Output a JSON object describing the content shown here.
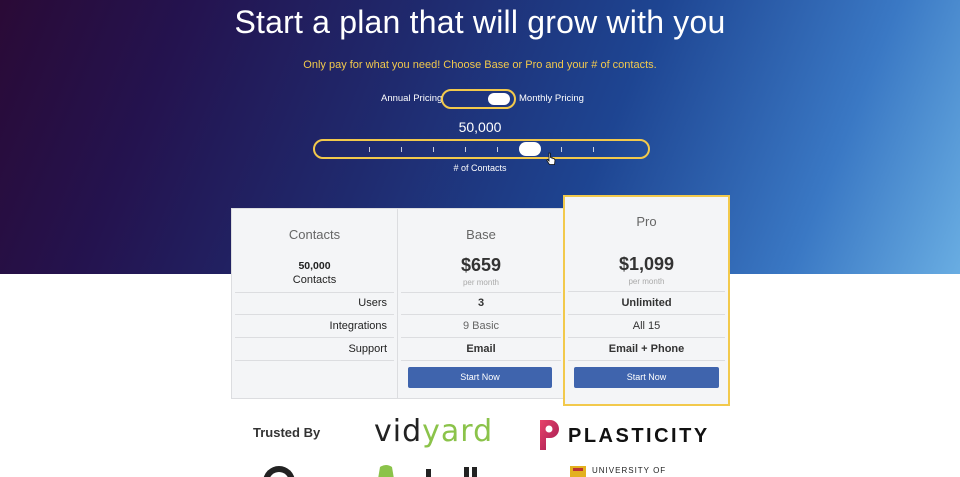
{
  "hero": {
    "headline": "Start a plan that will grow with you",
    "subline": "Only pay for what you need! Choose Base or Pro and your # of contacts."
  },
  "pricing_toggle": {
    "left_label": "Annual Pricing",
    "right_label": "Monthly Pricing",
    "selected": "Monthly Pricing"
  },
  "contacts_slider": {
    "value_label": "50,000",
    "caption": "# of Contacts",
    "position_fraction": 0.64
  },
  "table": {
    "contacts_col": {
      "title": "Contacts",
      "count": "50,000",
      "unit": "Contacts",
      "rows": [
        "Users",
        "Integrations",
        "Support"
      ]
    },
    "base": {
      "title": "Base",
      "price": "$659",
      "period": "per month",
      "users": "3",
      "integrations": "9 Basic",
      "support": "Email",
      "cta": "Start Now"
    },
    "pro": {
      "title": "Pro",
      "price": "$1,099",
      "period": "per month",
      "users": "Unlimited",
      "integrations": "All 15",
      "support": "Email + Phone",
      "cta": "Start Now"
    }
  },
  "trusted": {
    "label": "Trusted By",
    "logos": {
      "vidyard_a": "vid",
      "vidyard_b": "yard",
      "plasticity": "PLASTICITY",
      "waterloo_top": "UNIVERSITY OF"
    }
  },
  "colors": {
    "accent_yellow": "#f2c94c",
    "button_blue": "#3f64ad",
    "vidyard_green": "#8bc34a"
  },
  "icons": [
    "toggle-knob",
    "slider-knob",
    "pointer-cursor-icon",
    "plasticity-logo-icon"
  ]
}
